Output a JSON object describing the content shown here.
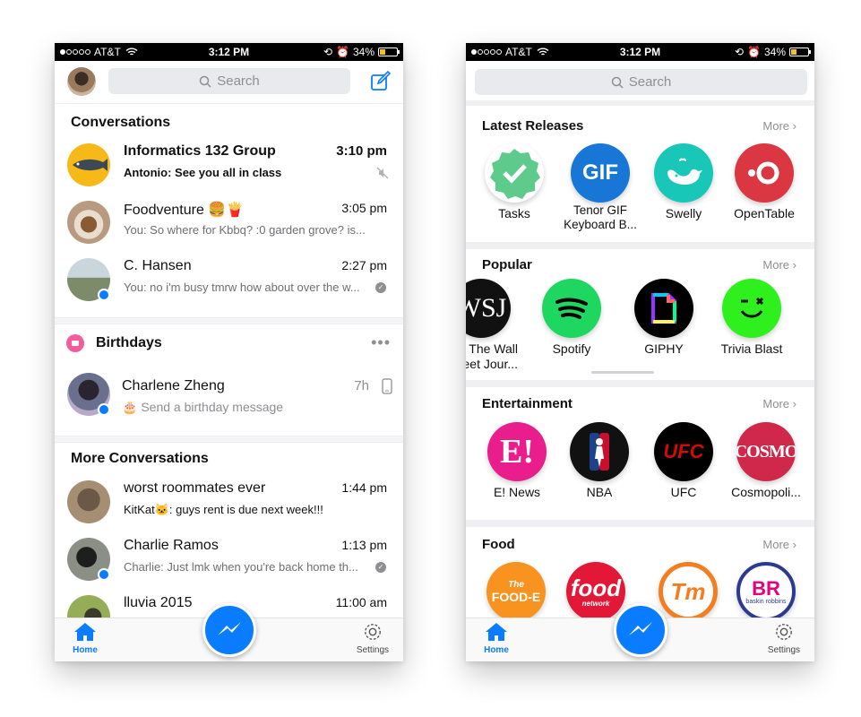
{
  "status_bar": {
    "carrier": "AT&T",
    "time": "3:12 PM",
    "battery": "34%",
    "battery_level": 0.34
  },
  "left": {
    "search_placeholder": "Search",
    "conversations_title": "Conversations",
    "conversations": [
      {
        "name": "Informatics 132 Group",
        "message": "Antonio: See you all in class",
        "time": "3:10 pm",
        "unread": true
      },
      {
        "name": "Foodventure 🍔🍟",
        "message": "You: So where for Kbbq? :0 garden grove? is...",
        "time": "3:05 pm",
        "unread": false
      },
      {
        "name": "C. Hansen",
        "message": "You: no i'm busy tmrw how about over the w...",
        "time": "2:27 pm",
        "unread": false
      }
    ],
    "birthdays_title": "Birthdays",
    "birthday": {
      "name": "Charlene Zheng",
      "action": "Send a birthday message",
      "time": "7h"
    },
    "more_title": "More Conversations",
    "more_conversations": [
      {
        "name": "worst roommates ever",
        "message": "KitKat🐱: guys rent is due next week!!!",
        "time": "1:44 pm"
      },
      {
        "name": "Charlie Ramos",
        "message": "Charlie: Just lmk when you're back home th...",
        "time": "1:13 pm"
      },
      {
        "name": "lluvia 2015",
        "message": "",
        "time": "11:00 am"
      }
    ],
    "tabs": {
      "home": "Home",
      "settings": "Settings"
    }
  },
  "right": {
    "search_placeholder": "Search",
    "more_label": "More",
    "sections": [
      {
        "title": "Latest Releases",
        "apps": [
          "Tasks",
          "Tenor GIF Keyboard B...",
          "Swelly",
          "OpenTable"
        ]
      },
      {
        "title": "Popular",
        "apps": [
          "The Wall Street Jour...",
          "Spotify",
          "GIPHY",
          "Trivia Blast"
        ]
      },
      {
        "title": "Entertainment",
        "apps": [
          "E! News",
          "NBA",
          "UFC",
          "Cosmopoli..."
        ]
      },
      {
        "title": "Food",
        "apps": [
          "Food-E",
          "Food Network",
          "TM",
          "Baskin Robbins"
        ]
      }
    ],
    "icon_text": {
      "wsj": "WSJ",
      "tenor": "GIF",
      "ufc": "UFC",
      "cosmo": "COSMO",
      "foode_top": "The",
      "foode": "FOOD-E",
      "foodnet": "food",
      "foodnet_sub": "network",
      "tm": "Tm",
      "br": "BR",
      "br_sub": "baskin robbins"
    },
    "tabs": {
      "home": "Home",
      "settings": "Settings"
    }
  },
  "colors": {
    "accent": "#0a7cff",
    "birthday": "#f35c9d",
    "battery": "#f3c21c"
  }
}
